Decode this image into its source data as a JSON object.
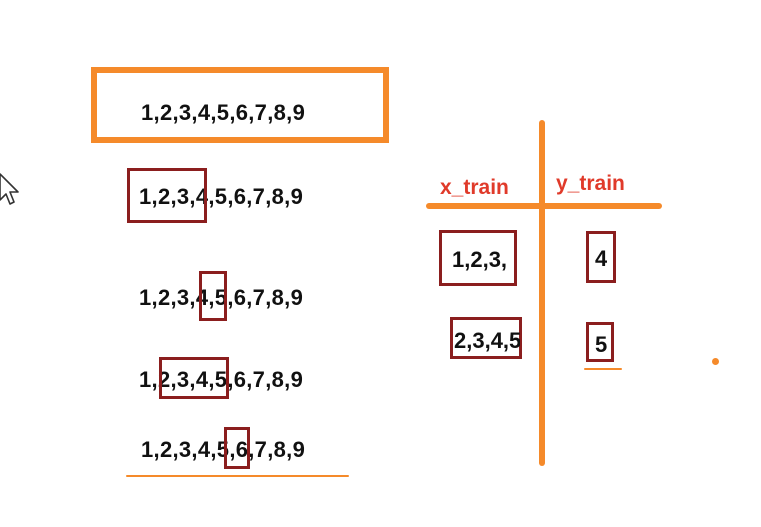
{
  "sequences": [
    "1,2,3,4,5,6,7,8,9",
    "1,2,3,4,5,6,7,8,9",
    "1,2,3,4,5,6,7,8,9",
    "1,2,3,4,5,6,7,8,9",
    "1,2,3,4,5,6,7,8,9"
  ],
  "table": {
    "x_header": "x_train",
    "y_header": "y_train",
    "rows": [
      {
        "x": "1,2,3,",
        "y": "4"
      },
      {
        "x": "2,3,4,5",
        "y": "5"
      }
    ]
  },
  "colors": {
    "accent_orange": "#f58a2a",
    "window_red": "#8b1e1e",
    "header_red": "#e03a2a"
  },
  "icons": {
    "pointer": "mouse-cursor-icon"
  }
}
